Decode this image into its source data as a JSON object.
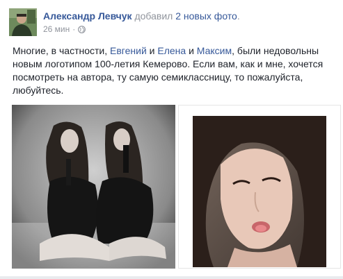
{
  "post": {
    "author": "Александр Левчук",
    "action_prefix": "добавил",
    "action_link": "2 новых фото",
    "action_suffix": ".",
    "time": "26 мин",
    "dot": "·",
    "privacy_icon": "globe-icon",
    "text": {
      "part1": "Многие, в частности, ",
      "mention1": "Евгений",
      "part2": " и ",
      "mention2": "Елена",
      "part3": " и ",
      "mention3": "Максим",
      "part4": ", были недовольны новым логотипом 100-летия Кемерово. Если вам, как и мне, хочется посмотреть на автора, ту самую семиклассницу, то пожалуйста, любуйтесь."
    }
  },
  "colors": {
    "link": "#365899",
    "text": "#1d2129",
    "meta": "#90949c"
  }
}
